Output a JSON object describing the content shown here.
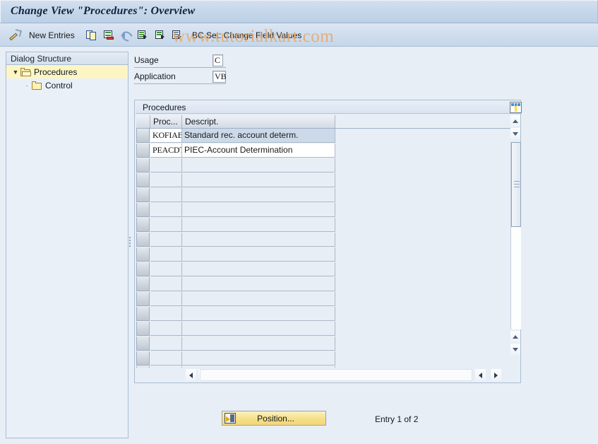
{
  "window": {
    "title": "Change View \"Procedures\": Overview"
  },
  "watermark": {
    "text": "www.tutorialkart.com",
    "color": "#e8a764"
  },
  "toolbar": {
    "new_entries_label": "New Entries",
    "bc_set_label": "BC Set: Change Field Values",
    "icons": [
      "pencil-display-change-icon",
      "copy-as-icon",
      "delete-icon",
      "undo-icon",
      "select-all-icon",
      "select-block-icon",
      "deselect-all-icon"
    ]
  },
  "sidebar": {
    "header": "Dialog Structure",
    "items": [
      {
        "label": "Procedures",
        "expander": "▼",
        "icon": "open-folder-icon",
        "selected": true,
        "indent": 0
      },
      {
        "label": "Control",
        "expander": "·",
        "icon": "folder-icon",
        "selected": false,
        "indent": 1
      }
    ]
  },
  "form": {
    "fields": [
      {
        "label": "Usage",
        "value": "C"
      },
      {
        "label": "Application",
        "value": "VB"
      }
    ]
  },
  "table": {
    "caption": "Procedures",
    "columns": [
      "Proc...",
      "Descript."
    ],
    "rows": [
      {
        "proc": "KOFIAB",
        "descript": "Standard rec. account determ.",
        "selected": true
      },
      {
        "proc": "PEACDT",
        "descript": "PIEC-Account Determination",
        "selected": false
      }
    ],
    "empty_row_count": 15,
    "column_config_icon": "table-settings-icon"
  },
  "footer": {
    "position_label": "Position...",
    "position_icon": "position-icon",
    "entry_status": "Entry 1 of 2"
  },
  "colors": {
    "window_bg": "#e8eef6",
    "title_bg": "#c5d6ea",
    "tree_selection": "#fdf6c4",
    "row_selection": "#ccd9e8",
    "button_yellow": "#f7e08c"
  }
}
